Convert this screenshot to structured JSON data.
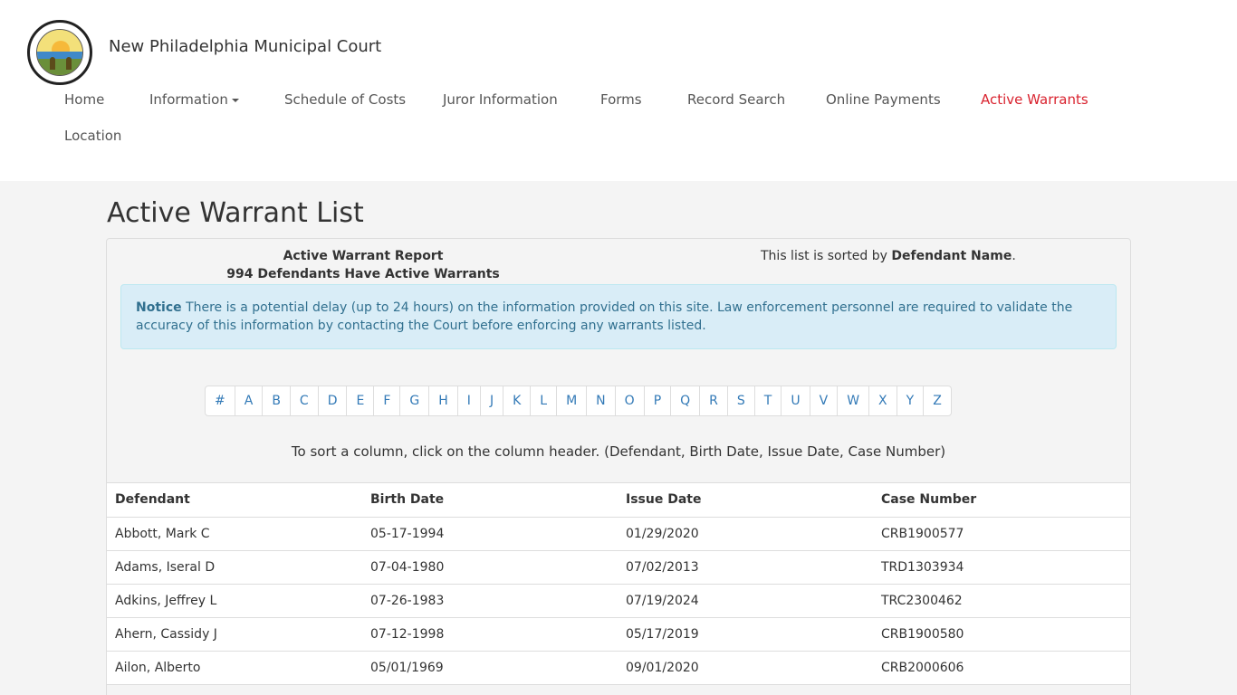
{
  "site": {
    "title": "New Philadelphia Municipal Court"
  },
  "nav": {
    "home": "Home",
    "information": "Information",
    "schedule": "Schedule of Costs",
    "juror": "Juror Information",
    "forms": "Forms",
    "record_search": "Record Search",
    "online_payments": "Online Payments",
    "active_warrants": "Active Warrants",
    "location": "Location",
    "active_color": "#d9232f"
  },
  "page": {
    "title": "Active Warrant List",
    "report_title": "Active Warrant Report",
    "report_count": "994 Defendants Have Active Warrants",
    "sort_prefix": "This list is sorted by ",
    "sort_field": "Defendant Name",
    "sort_suffix": ".",
    "notice_label": "Notice",
    "notice_text": " There is a potential delay (up to 24 hours) on the information provided on this site. Law enforcement personnel are required to validate the accuracy of this information by contacting the Court before enforcing any warrants listed.",
    "sort_help": "To sort a column, click on the column header. (Defendant, Birth Date, Issue Date, Case Number)"
  },
  "alphabet": [
    "#",
    "A",
    "B",
    "C",
    "D",
    "E",
    "F",
    "G",
    "H",
    "I",
    "J",
    "K",
    "L",
    "M",
    "N",
    "O",
    "P",
    "Q",
    "R",
    "S",
    "T",
    "U",
    "V",
    "W",
    "X",
    "Y",
    "Z"
  ],
  "table": {
    "headers": {
      "defendant": "Defendant",
      "birth_date": "Birth Date",
      "issue_date": "Issue Date",
      "case_number": "Case Number"
    },
    "rows": [
      {
        "defendant": "Abbott, Mark C",
        "birth_date": "05-17-1994",
        "issue_date": "01/29/2020",
        "case_number": "CRB1900577"
      },
      {
        "defendant": "Adams, Iseral D",
        "birth_date": "07-04-1980",
        "issue_date": "07/02/2013",
        "case_number": "TRD1303934"
      },
      {
        "defendant": "Adkins, Jeffrey L",
        "birth_date": "07-26-1983",
        "issue_date": "07/19/2024",
        "case_number": "TRC2300462"
      },
      {
        "defendant": "Ahern, Cassidy J",
        "birth_date": "07-12-1998",
        "issue_date": "05/17/2019",
        "case_number": "CRB1900580"
      },
      {
        "defendant": "Ailon, Alberto",
        "birth_date": "05/01/1969",
        "issue_date": "09/01/2020",
        "case_number": "CRB2000606"
      }
    ]
  }
}
